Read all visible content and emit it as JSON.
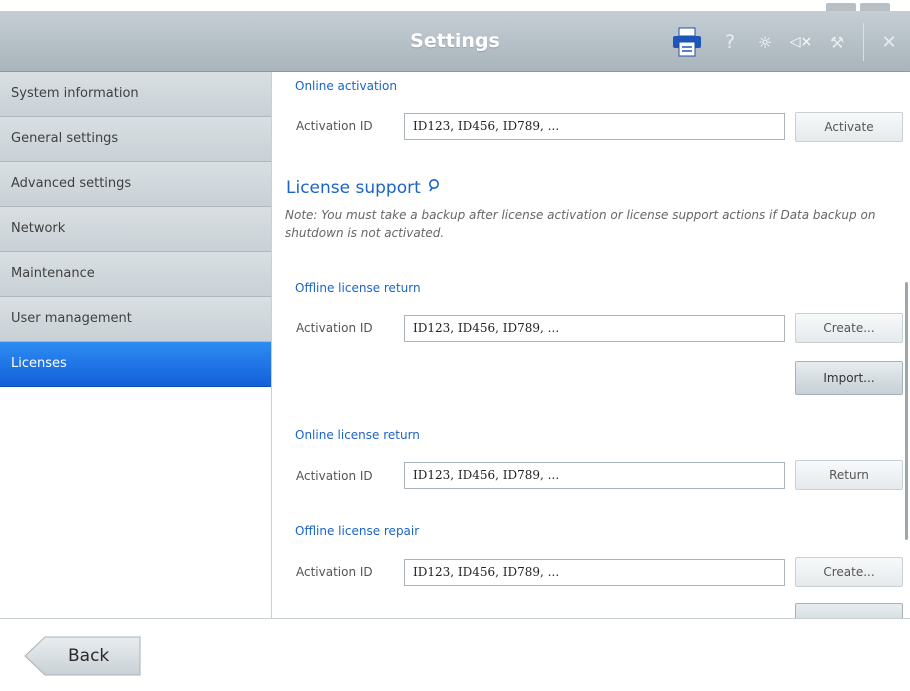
{
  "header": {
    "title": "Settings",
    "icons": [
      "printer-icon",
      "help-icon",
      "brightness-icon",
      "mute-icon",
      "wrench-icon",
      "close-icon"
    ],
    "help_glyph": "?",
    "brightness_glyph": "☼",
    "mute_glyph": "◁×",
    "wrench_glyph": "⚒",
    "close_glyph": "✕"
  },
  "sidebar": {
    "items": [
      {
        "label": "System information"
      },
      {
        "label": "General settings"
      },
      {
        "label": "Advanced settings"
      },
      {
        "label": "Network"
      },
      {
        "label": "Maintenance"
      },
      {
        "label": "User management"
      },
      {
        "label": "Licenses",
        "active": true
      }
    ]
  },
  "content": {
    "online_activation": {
      "heading": "Online activation",
      "field_label": "Activation ID",
      "field_value": "ID123, ID456, ID789, ...",
      "button": "Activate"
    },
    "license_support": {
      "title": "License support",
      "note": "Note: You must take a backup after license activation or license support actions if Data backup on shutdown is not activated."
    },
    "offline_return": {
      "heading": "Offline license return",
      "field_label": "Activation ID",
      "field_value": "ID123, ID456, ID789, ...",
      "create_button": "Create...",
      "import_button": "Import..."
    },
    "online_return": {
      "heading": "Online license return",
      "field_label": "Activation ID",
      "field_value": "ID123, ID456, ID789, ...",
      "button": "Return"
    },
    "offline_repair": {
      "heading": "Offline license repair",
      "field_label": "Activation ID",
      "field_value": "ID123, ID456, ID789, ...",
      "create_button": "Create..."
    }
  },
  "footer": {
    "back_label": "Back"
  },
  "colors": {
    "accent": "#1a64c8",
    "active_nav": "#1360d9",
    "header": "#b3bdc3"
  }
}
